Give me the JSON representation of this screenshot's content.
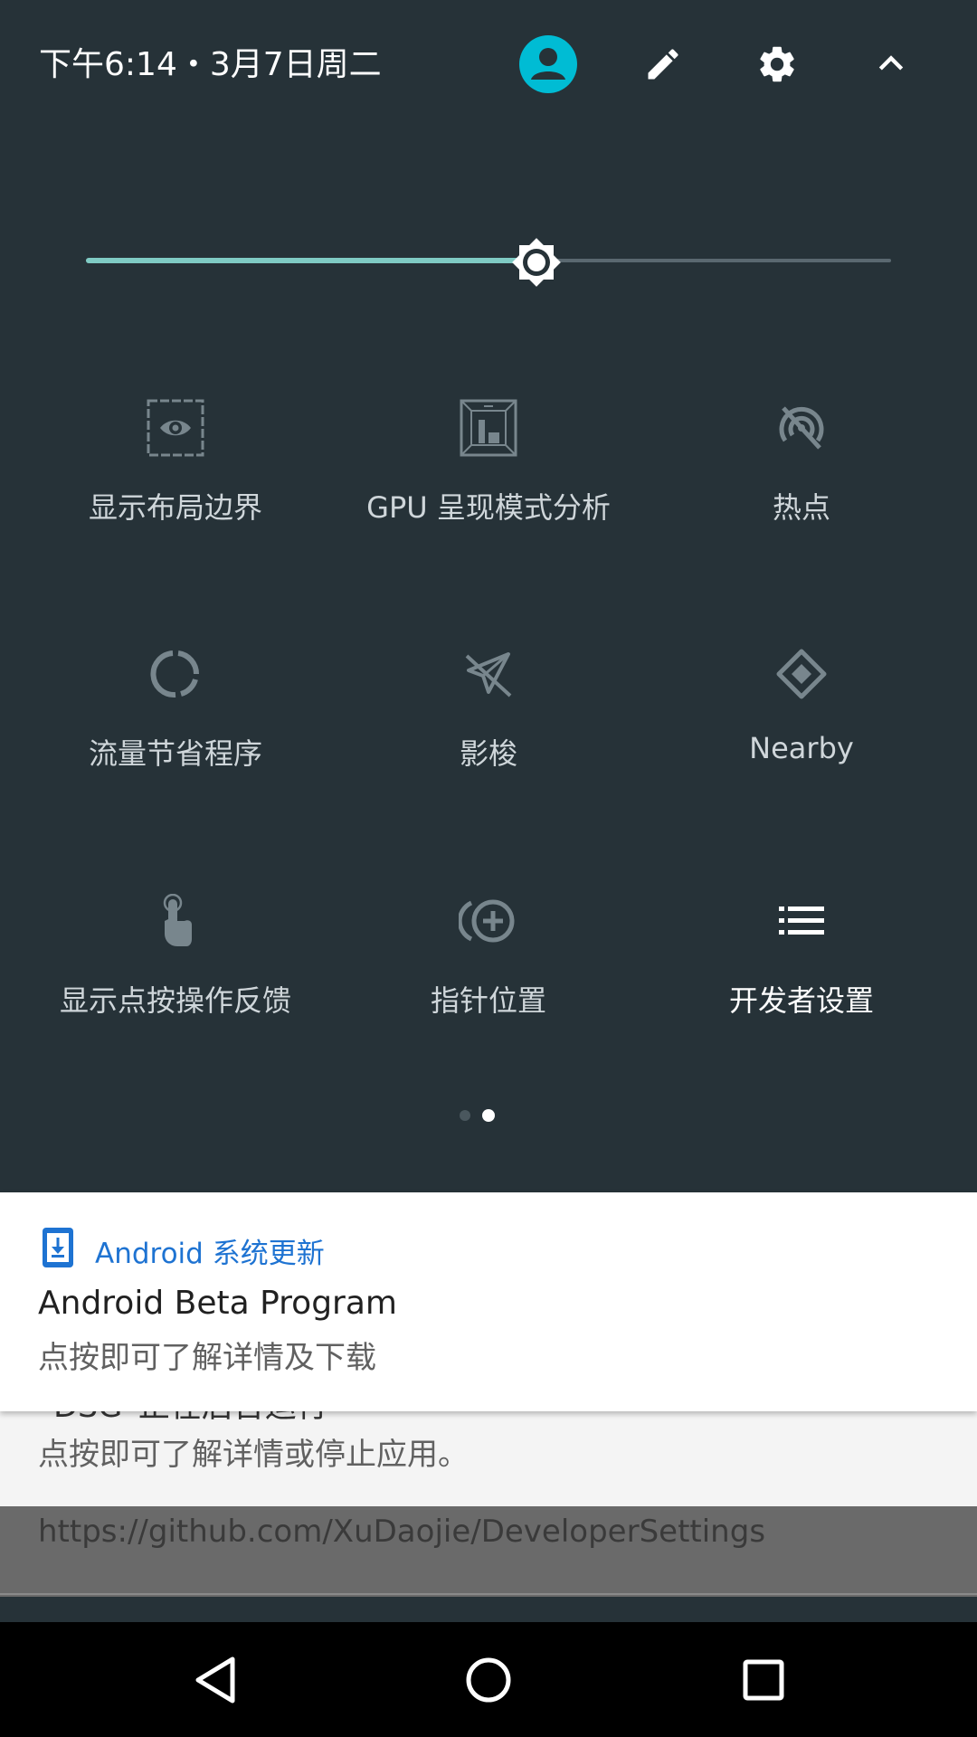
{
  "status_header": {
    "datetime": "下午6:14・3月7日周二",
    "icons": [
      "account-icon",
      "edit-icon",
      "settings-icon",
      "collapse-icon"
    ],
    "accent_color": "#00bcd4"
  },
  "brightness": {
    "level": 0.56,
    "fill_color": "#7fcbc4"
  },
  "tiles": [
    {
      "label": "显示布局边界",
      "icon": "layout-bounds-icon"
    },
    {
      "label": "GPU 呈现模式分析",
      "icon": "gpu-profile-icon"
    },
    {
      "label": "热点",
      "icon": "hotspot-off-icon"
    },
    {
      "label": "流量节省程序",
      "icon": "data-saver-icon"
    },
    {
      "label": "影梭",
      "icon": "shadowsocks-off-icon"
    },
    {
      "label": "Nearby",
      "icon": "nearby-icon"
    },
    {
      "label": "显示点按操作反馈",
      "icon": "show-taps-icon"
    },
    {
      "label": "指针位置",
      "icon": "pointer-location-icon"
    },
    {
      "label": "开发者设置",
      "icon": "developer-settings-icon"
    }
  ],
  "pager": {
    "pages": 2,
    "current": 2
  },
  "notifications": [
    {
      "app_name": "Android 系统更新",
      "title": "Android Beta Program",
      "text": "点按即可了解详情及下载",
      "app_color": "#1e73d2"
    },
    {
      "title": "“DSG”正在后台运行",
      "text": "点按即可了解详情或停止应用。"
    },
    {
      "text": "https://github.com/XuDaojie/DeveloperSettings"
    }
  ],
  "navbar": {
    "buttons": [
      "back",
      "home",
      "recents"
    ]
  }
}
